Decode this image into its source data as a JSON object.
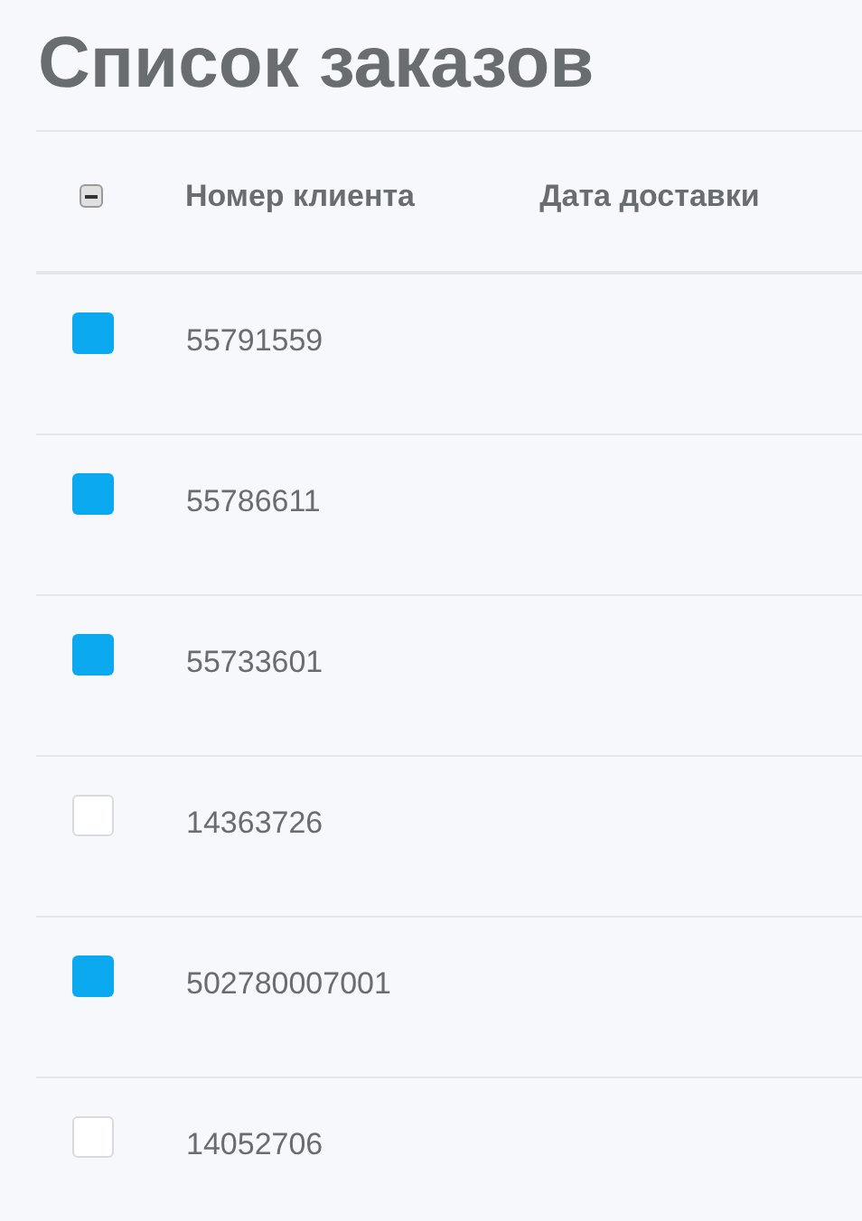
{
  "title": "Список заказов",
  "table": {
    "select_all": {
      "indeterminate": true
    },
    "columns": [
      "Номер клиента",
      "Дата доставки"
    ],
    "rows": [
      {
        "selected": true,
        "customer": "55791559"
      },
      {
        "selected": true,
        "customer": "55786611"
      },
      {
        "selected": true,
        "customer": "55733601"
      },
      {
        "selected": false,
        "customer": "14363726"
      },
      {
        "selected": true,
        "customer": "502780007001"
      },
      {
        "selected": false,
        "customer": "14052706"
      }
    ]
  }
}
